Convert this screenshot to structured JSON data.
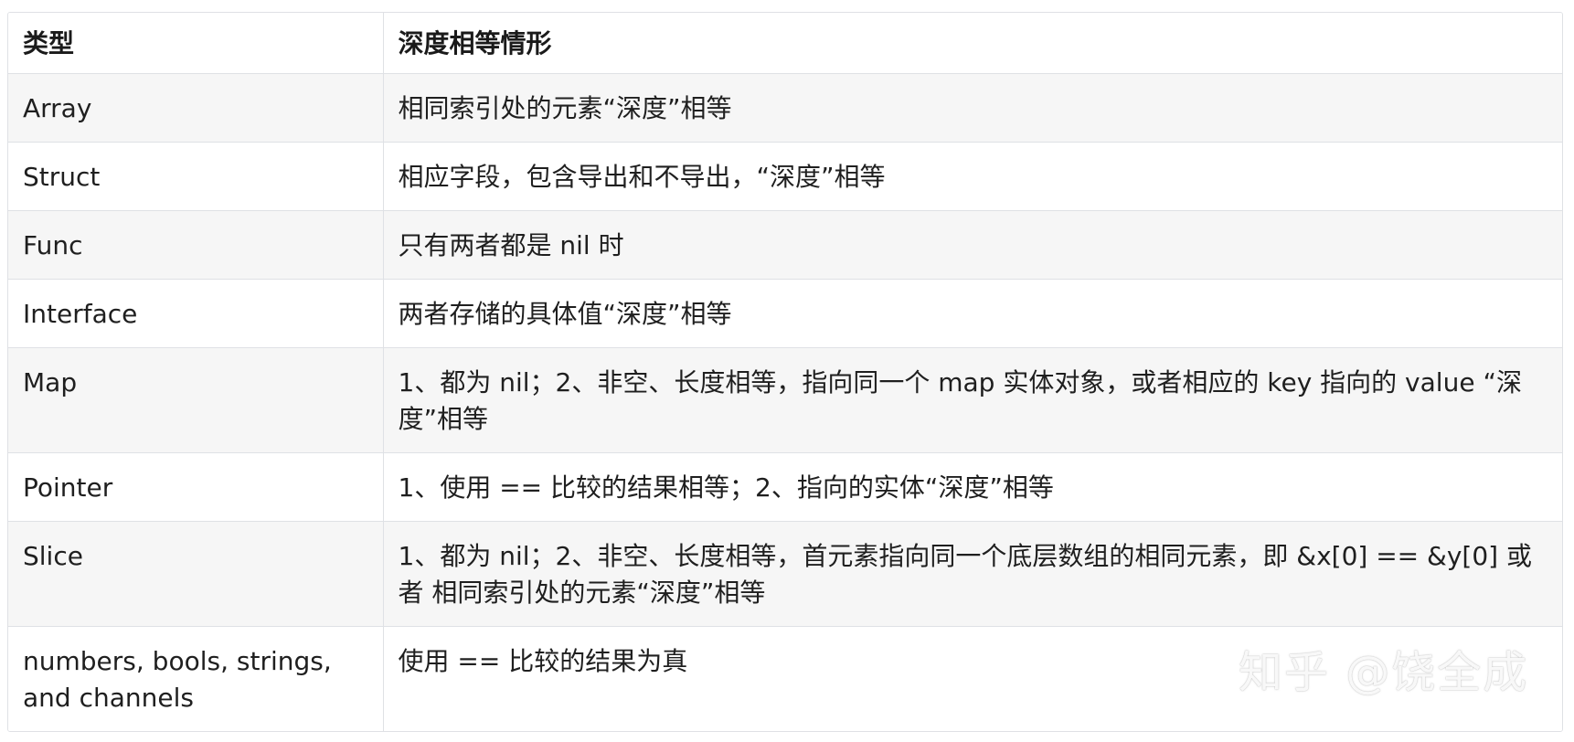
{
  "table": {
    "headers": [
      "类型",
      "深度相等情形"
    ],
    "rows": [
      {
        "type": "Array",
        "desc": "相同索引处的元素“深度”相等"
      },
      {
        "type": "Struct",
        "desc": "相应字段，包含导出和不导出，“深度”相等"
      },
      {
        "type": "Func",
        "desc": "只有两者都是 nil 时"
      },
      {
        "type": "Interface",
        "desc": "两者存储的具体值“深度”相等"
      },
      {
        "type": "Map",
        "desc": "1、都为 nil；2、非空、长度相等，指向同一个 map 实体对象，或者相应的 key 指向的 value “深度”相等"
      },
      {
        "type": "Pointer",
        "desc": "1、使用 == 比较的结果相等；2、指向的实体“深度”相等"
      },
      {
        "type": "Slice",
        "desc": "1、都为 nil；2、非空、长度相等，首元素指向同一个底层数组的相同元素，即 &x[0] == &y[0] 或者 相同索引处的元素“深度”相等"
      },
      {
        "type": "numbers, bools, strings, and channels",
        "desc": "使用 == 比较的结果为真"
      }
    ]
  },
  "watermark": {
    "text": "知乎 @饶全成"
  }
}
